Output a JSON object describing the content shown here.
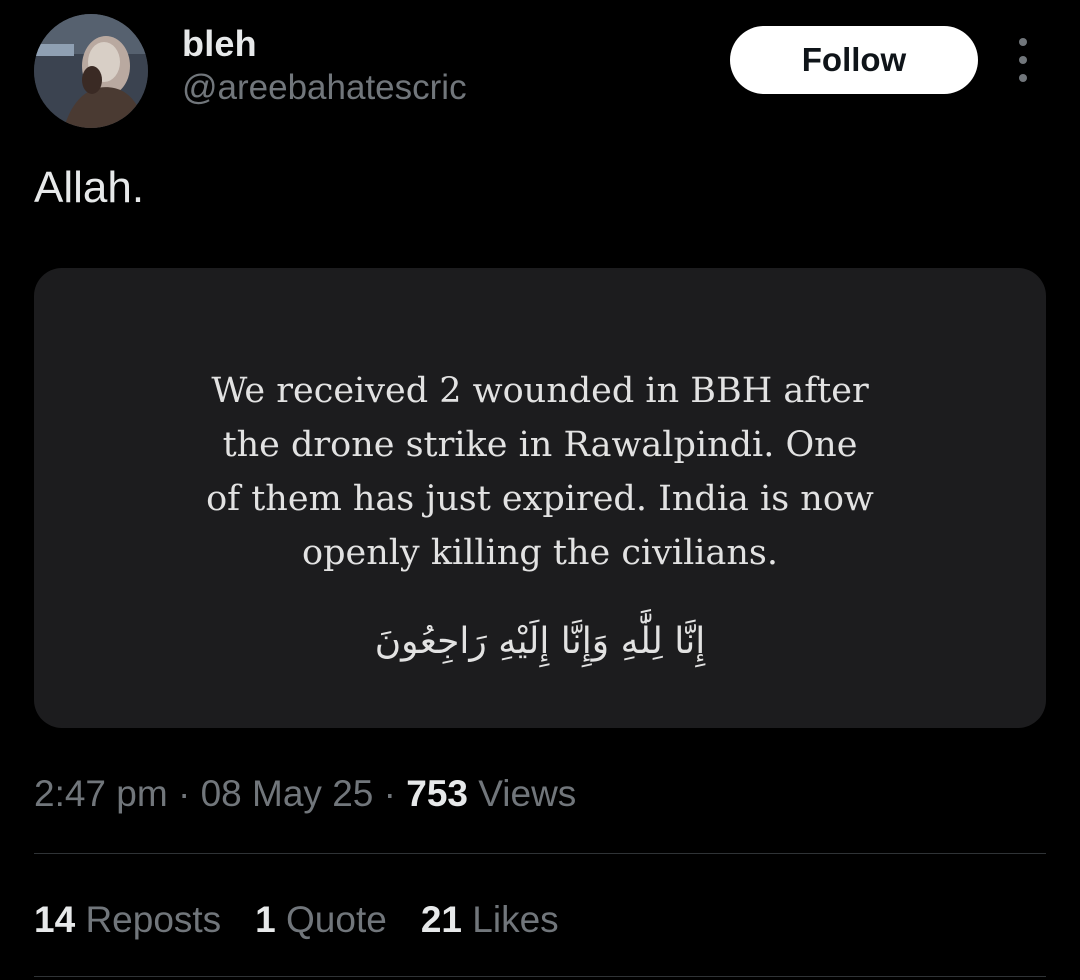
{
  "author": {
    "display_name": "bleh",
    "handle": "@areebahatescric",
    "avatar_icon": "profile-photo"
  },
  "actions": {
    "follow_label": "Follow",
    "more_icon": "more-vertical-icon"
  },
  "tweet": {
    "text": "Allah.",
    "media": {
      "quote_lines": [
        "We received 2 wounded in BBH after",
        "the drone strike in Rawalpindi. One",
        "of them has just expired. India is now",
        "openly killing the civilians."
      ],
      "arabic_line": "إِنَّا لِلَّٰهِ وَإِنَّا إِلَيْهِ رَاجِعُونَ"
    }
  },
  "meta": {
    "time": "2:47 pm",
    "separator": "·",
    "date": "08 May 25",
    "views_count": "753",
    "views_label": "Views"
  },
  "stats": {
    "reposts_count": "14",
    "reposts_label": "Reposts",
    "quotes_count": "1",
    "quotes_label": "Quote",
    "likes_count": "21",
    "likes_label": "Likes"
  },
  "colors": {
    "background": "#000000",
    "primary_text": "#e7e9ea",
    "secondary_text": "#71767b",
    "card_background": "#1c1c1e",
    "divider": "#2f3336",
    "follow_button_bg": "#ffffff"
  }
}
